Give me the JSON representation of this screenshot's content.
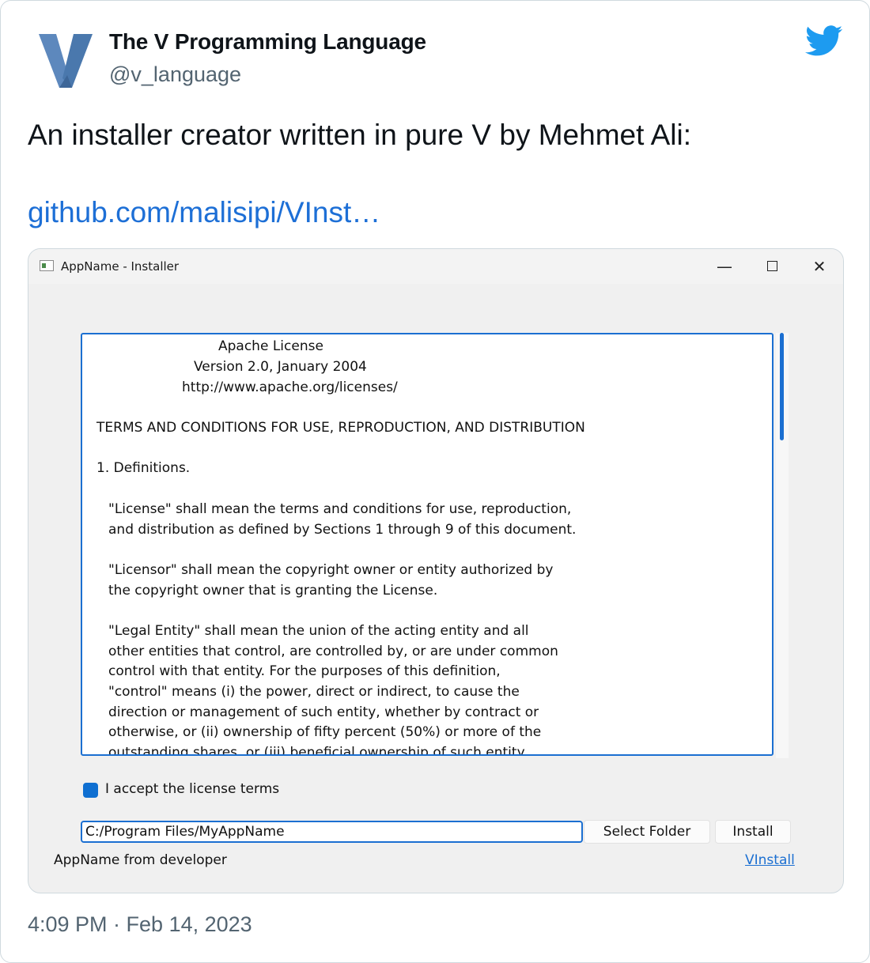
{
  "tweet": {
    "display_name": "The V Programming Language",
    "handle": "@v_language",
    "text": "An installer creator written in pure V by Mehmet Ali:",
    "link": "github.com/malisipi/VInst…",
    "timestamp": "4:09 PM · Feb 14, 2023",
    "avatar_icon": "v-logo-icon",
    "brand_icon": "twitter-bird-icon",
    "brand_color": "#1d9bf0"
  },
  "window": {
    "title": "AppName - Installer",
    "minimize_glyph": "—",
    "close_glyph": "✕",
    "accent_color": "#1b6fd1"
  },
  "license": {
    "lines": [
      "Apache License",
      "Version 2.0, January 2004",
      "http://www.apache.org/licenses/",
      "TERMS AND CONDITIONS FOR USE, REPRODUCTION, AND DISTRIBUTION",
      "1. Definitions.",
      "\"License\" shall mean the terms and conditions for use, reproduction,",
      "and distribution as defined by Sections 1 through 9 of this document.",
      "\"Licensor\" shall mean the copyright owner or entity authorized by",
      "the copyright owner that is granting the License.",
      "\"Legal Entity\" shall mean the union of the acting entity and all",
      "other entities that control, are controlled by, or are under common",
      "control with that entity. For the purposes of this definition,",
      "\"control\" means (i) the power, direct or indirect, to cause the",
      "direction or management of such entity, whether by contract or",
      "otherwise, or (ii) ownership of fifty percent (50%) or more of the",
      "outstanding shares, or (iii) beneficial ownership of such entity."
    ]
  },
  "form": {
    "accept_label": "I accept the license terms",
    "accept_checked": true,
    "install_path": "C:/Program Files/MyAppName",
    "select_folder_label": "Select Folder",
    "install_label": "Install",
    "footer_left": "AppName from developer",
    "footer_link": "VInstall"
  }
}
